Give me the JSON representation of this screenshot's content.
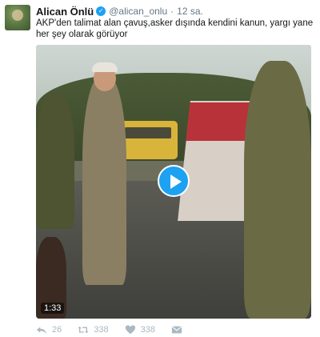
{
  "tweet": {
    "author_name": "Alican Önlü",
    "verified_mark": "✓",
    "handle": "@alican_onlu",
    "separator": "·",
    "time": "12 sa.",
    "text": "AKP'den talimat alan çavuş,asker dışında kendini kanun, yargı yane her şey olarak görüyor"
  },
  "video": {
    "duration": "1:33"
  },
  "actions": {
    "reply_count": "26",
    "retweet_count": "338",
    "like_count": "338"
  },
  "icons": {
    "reply": "reply-icon",
    "retweet": "retweet-icon",
    "like": "heart-icon",
    "dm": "envelope-icon",
    "play": "play-icon"
  },
  "colors": {
    "accent": "#1da1f2",
    "muted": "#aab8c2",
    "text": "#14171a"
  }
}
